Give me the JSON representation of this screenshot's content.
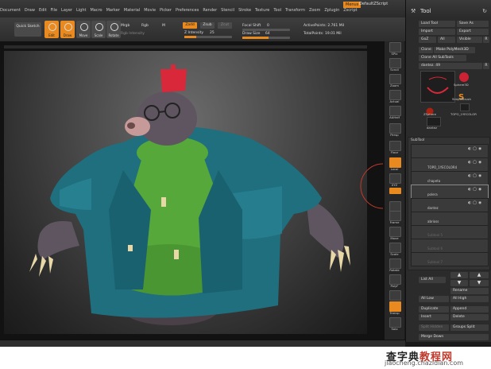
{
  "menubar": {
    "menus": [
      "Document",
      "Draw",
      "Edit",
      "File",
      "Layer",
      "Light",
      "Macro",
      "Marker",
      "Material",
      "Movie",
      "Picker",
      "Preferences",
      "Render",
      "Stencil",
      "Stroke",
      "Texture",
      "Tool",
      "Transform",
      "Zoom",
      "Zplugin",
      "Zscript"
    ],
    "highlight": "Menus",
    "default_script": "DefaultZScript"
  },
  "toolbar": {
    "quick_sketch": "Quick Sketch",
    "edit": "Edit",
    "draw": "Draw",
    "move": "Move",
    "scale": "Scale",
    "rotate": "Rotate",
    "mrgb": "Mrgb",
    "rgb": "Rgb",
    "m": "M",
    "zadd": "Zadd",
    "zsub": "Zsub",
    "zcut": "Zcut",
    "rgb_intensity": "Rgb Intensity",
    "z_intensity_label": "Z Intensity",
    "z_intensity_value": "25",
    "focal_shift_label": "Focal Shift",
    "focal_shift_value": "0",
    "draw_size_label": "Draw Size",
    "draw_size_value": "64",
    "active_points": "ActivePoints: 2.761 Mil",
    "total_points": "TotalPoints: 19.01 Mil",
    "z_intensity_level": 0.25,
    "draw_size_level": 0.55
  },
  "shelf": {
    "items": [
      "SPix",
      "Scroll",
      "Zoom",
      "Actual",
      "AAHalf",
      "Persp",
      "Floor",
      "Local",
      "XYZ",
      "",
      "",
      "Frame",
      "Move",
      "Scale",
      "Rotate",
      "PolyF",
      "",
      "Transp",
      "",
      "Solo"
    ]
  },
  "palette": {
    "title": "Tool",
    "load_tool": "Load Tool",
    "save_as": "Save As",
    "import": "Import",
    "export": "Export",
    "goz": "GoZ",
    "all": "All",
    "visible": "Visible",
    "r": "R",
    "clone": "Clone",
    "make_polymesh3d": "Make PolyMesh3D",
    "clone_all_subtools": "Clone All SubTools",
    "current_tool": "dantez. 49",
    "r_label": "R",
    "thumbs": [
      "Sphere3D",
      "SimpleBrush",
      "ZSphere",
      "TOPO_1YECOLOR",
      "dantez"
    ],
    "subtool_header": "SubTool",
    "subtools": [
      "",
      "TOPO_1YECOLOR4",
      "chapeta",
      "polera",
      "dantez",
      "abrioss"
    ],
    "empty_slots": [
      "Subtool 5",
      "Subtool 6",
      "Subtool 7"
    ],
    "list_all": "List All",
    "rename": "Rename",
    "all_low": "All Low",
    "all_high": "All High",
    "duplicate": "Duplicate",
    "append": "Append",
    "insert": "Insert",
    "delete": "Delete",
    "split_hidden": "Split Hidden",
    "groups_split": "Groups Split",
    "merge_down": "Merge Down"
  },
  "watermark": {
    "brand_a": "查字典",
    "brand_b": "教程网",
    "url": "jiaocheng.chazidian.com"
  },
  "colors": {
    "accent": "#e88a1f",
    "coat": "#1f6f7e",
    "sweater": "#56a83a",
    "hat": "#d8283a",
    "skin": "#5e5560"
  }
}
